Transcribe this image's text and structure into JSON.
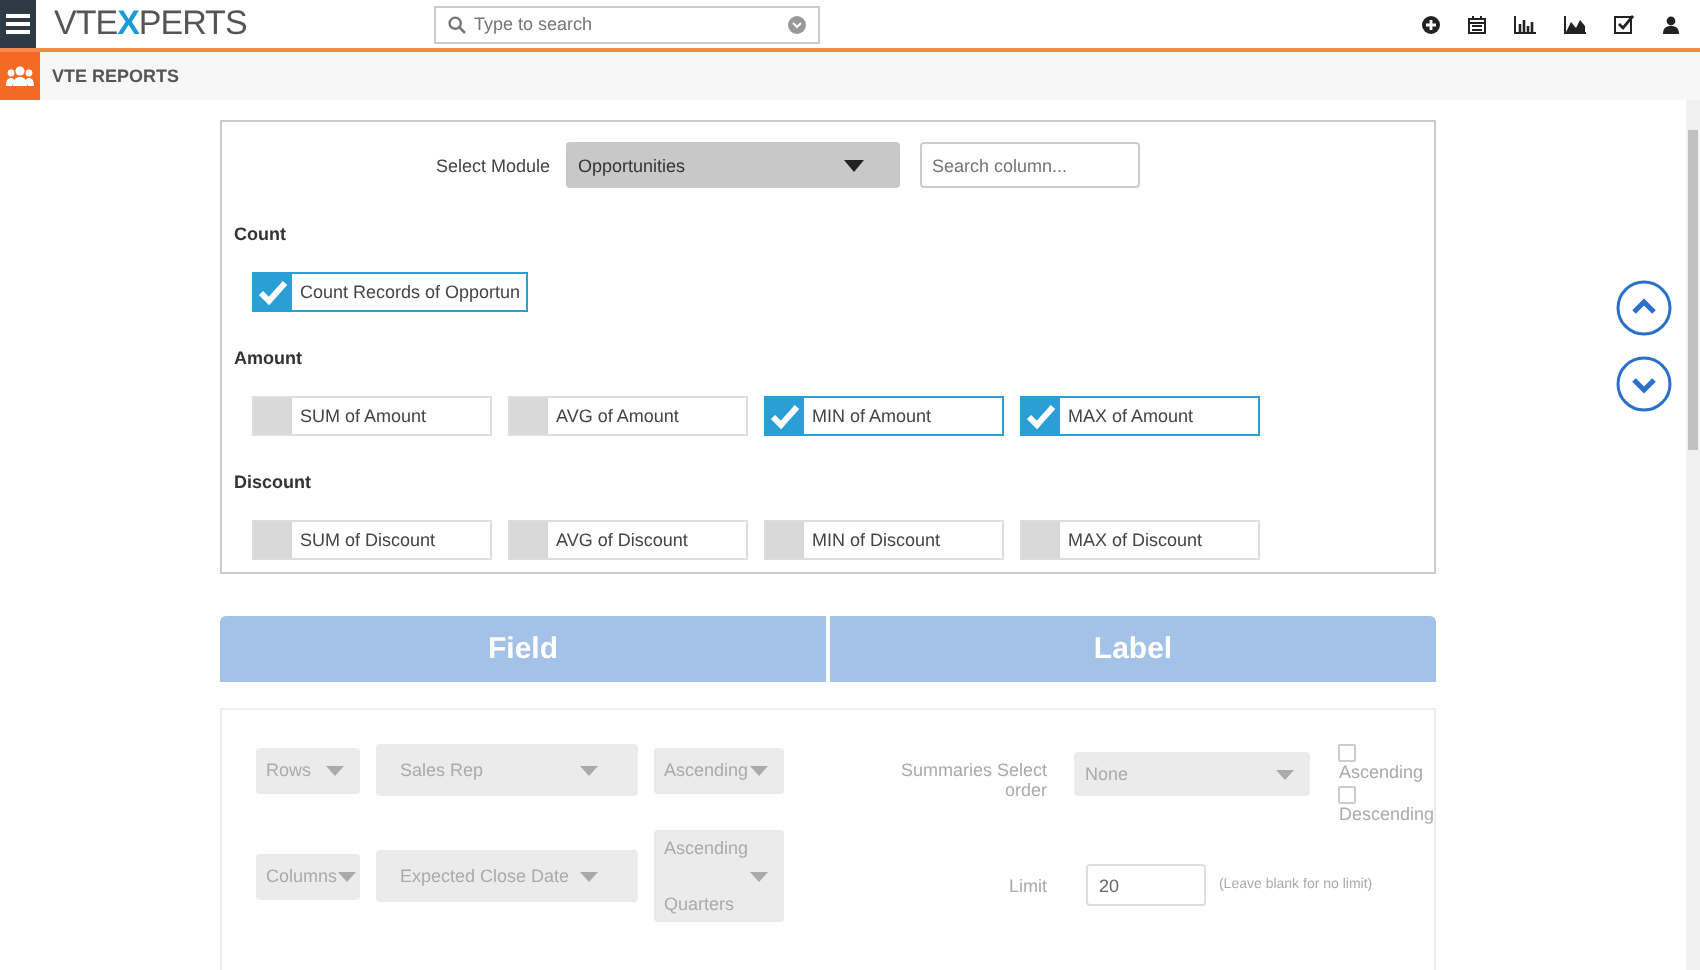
{
  "topbar": {
    "logo": [
      {
        "text": "VTE",
        "accent": false
      },
      {
        "text": "X",
        "accent": true
      },
      {
        "text": "PERTS",
        "accent": false
      }
    ],
    "search": {
      "placeholder": "Type to search"
    }
  },
  "header": {
    "title": "VTE REPORTS"
  },
  "module": {
    "label": "Select Module",
    "value": "Opportunities",
    "search_placeholder": "Search column..."
  },
  "groups": [
    {
      "title": "Count",
      "items": [
        {
          "label": "Count Records of Opportun",
          "checked": true
        }
      ]
    },
    {
      "title": "Amount",
      "items": [
        {
          "label": "SUM of Amount",
          "checked": false
        },
        {
          "label": "AVG of Amount",
          "checked": false
        },
        {
          "label": "MIN of Amount",
          "checked": true
        },
        {
          "label": "MAX of Amount",
          "checked": true
        }
      ]
    },
    {
      "title": "Discount",
      "items": [
        {
          "label": "SUM of Discount",
          "checked": false
        },
        {
          "label": "AVG of Discount",
          "checked": false
        },
        {
          "label": "MIN of Discount",
          "checked": false
        },
        {
          "label": "MAX of Discount",
          "checked": false
        }
      ]
    }
  ],
  "columns": [
    "Field",
    "Label"
  ],
  "grouping": {
    "disabled": true,
    "rows": [
      {
        "type": "Rows",
        "field": "Sales Rep",
        "order": [
          "Ascending"
        ]
      },
      {
        "type": "Columns",
        "field": "Expected Close Date",
        "order": [
          "Ascending",
          "Quarters"
        ]
      }
    ],
    "summaries": {
      "label": "Summaries Select order",
      "value": "None",
      "options": [
        {
          "label": "Ascending",
          "checked": false
        },
        {
          "label": "Descending",
          "checked": false
        }
      ]
    },
    "limit": {
      "label": "Limit",
      "value": "20",
      "hint": "(Leave blank for no limit)"
    }
  }
}
